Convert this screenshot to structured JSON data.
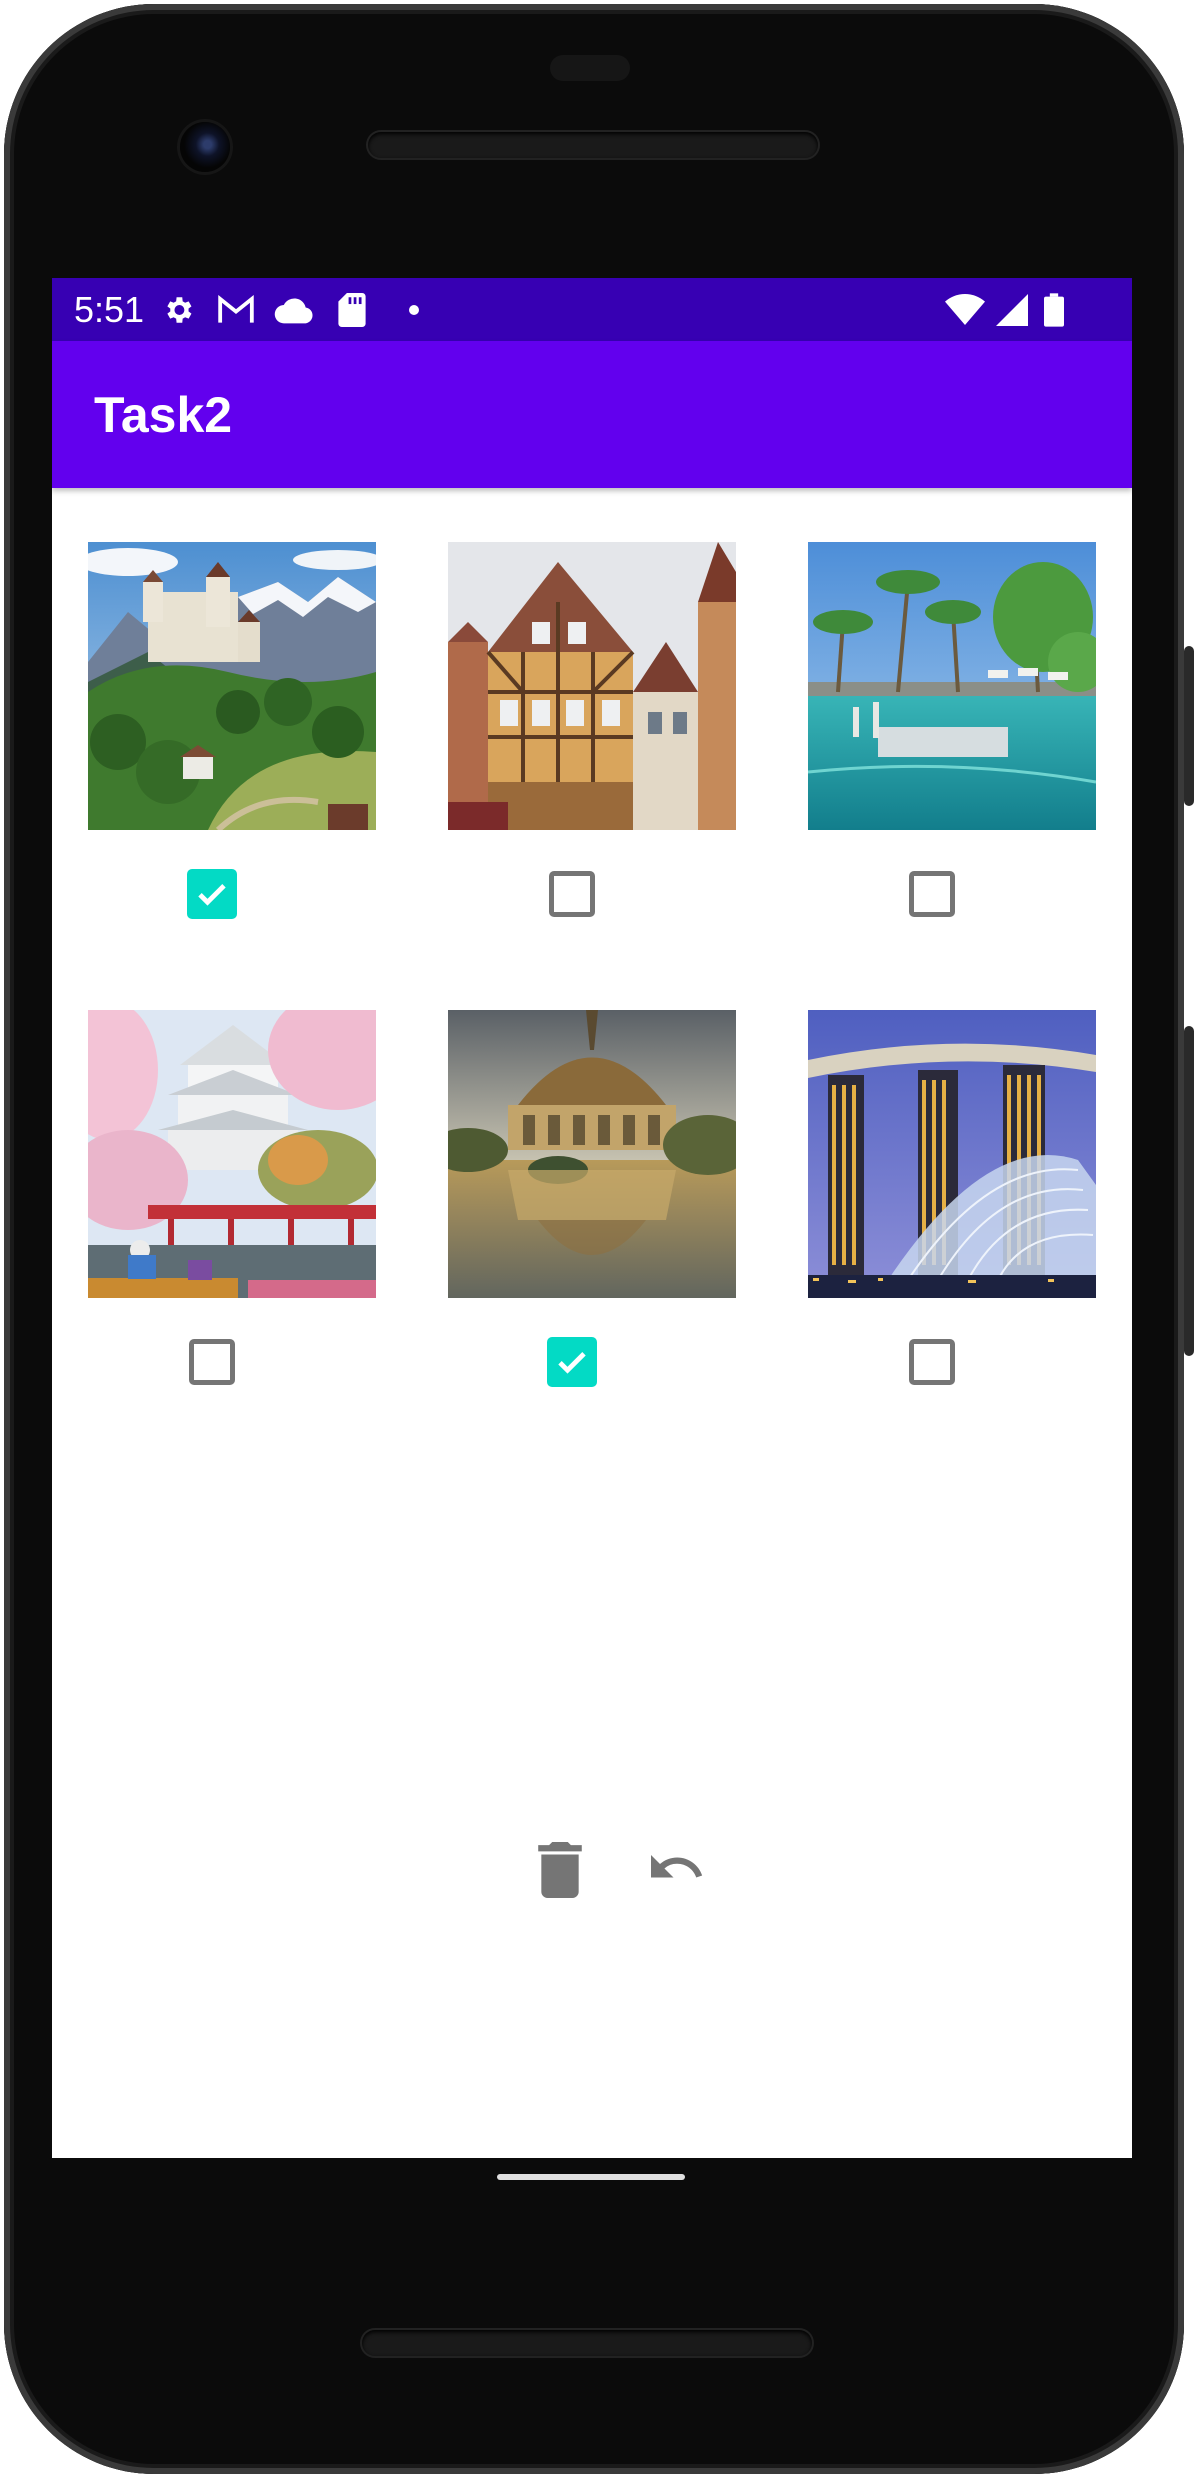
{
  "status_bar": {
    "time": "5:51",
    "left_icons": [
      "settings-icon",
      "gmail-icon",
      "cloud-icon",
      "sd-card-icon",
      "notification-dot-icon"
    ],
    "right_icons": [
      "wifi-icon",
      "cellular-signal-icon",
      "battery-icon"
    ]
  },
  "app_bar": {
    "title": "Task2"
  },
  "grid": {
    "items": [
      {
        "image": "mountain-castle-photo",
        "checked": true
      },
      {
        "image": "timber-house-town-photo",
        "checked": false
      },
      {
        "image": "resort-pool-palms-photo",
        "checked": false
      },
      {
        "image": "japanese-castle-cherry-blossom-photo",
        "checked": false
      },
      {
        "image": "domed-building-reflection-photo",
        "checked": true
      },
      {
        "image": "marina-bay-skyline-photo",
        "checked": false
      }
    ]
  },
  "actions": {
    "delete_icon": "trash-icon",
    "undo_icon": "undo-icon"
  },
  "colors": {
    "status_bar": "#3700b3",
    "app_bar": "#6200ee",
    "checkbox_checked": "#03dac5",
    "checkbox_unchecked": "#757575",
    "action_icon": "#757575"
  }
}
